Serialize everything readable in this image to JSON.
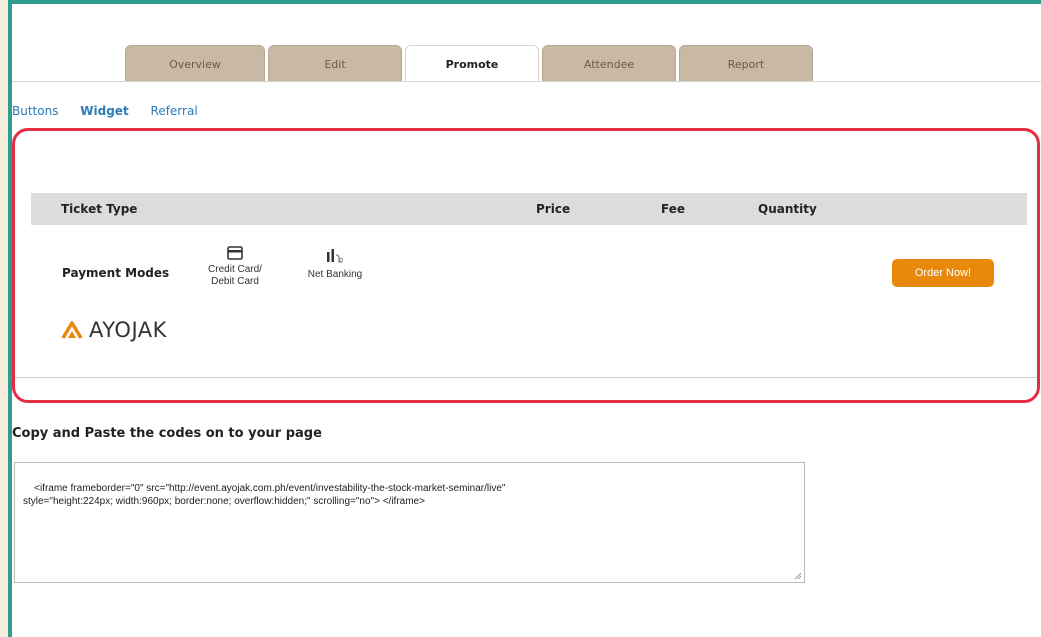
{
  "tabs": [
    {
      "label": "Overview",
      "active": false
    },
    {
      "label": "Edit",
      "active": false
    },
    {
      "label": "Promote",
      "active": true
    },
    {
      "label": "Attendee",
      "active": false
    },
    {
      "label": "Report",
      "active": false
    }
  ],
  "subnav": {
    "buttons": "Buttons",
    "widget": "Widget",
    "referral": "Referral",
    "current": "Widget"
  },
  "widget_preview": {
    "headers": {
      "ticket_type": "Ticket Type",
      "price": "Price",
      "fee": "Fee",
      "quantity": "Quantity"
    },
    "payment_modes_label": "Payment Modes",
    "payment_modes": [
      {
        "icon": "credit-card-icon",
        "line1": "Credit Card/",
        "line2": "Debit Card"
      },
      {
        "icon": "bank-icon",
        "line1": "Net Banking",
        "line2": ""
      }
    ],
    "order_button": "Order Now!",
    "brand_name": "AYOJAK",
    "highlight_color": "#e42c45",
    "button_color": "#e9890c"
  },
  "code_section": {
    "title": "Copy and Paste the codes on to your page",
    "code": "<iframe frameborder=\"0\" src=\"http://event.ayojak.com.ph/event/investability-the-stock-market-seminar/live\"\nstyle=\"height:224px; width:960px; border:none; overflow:hidden;\" scrolling=\"no\"> </iframe>"
  }
}
